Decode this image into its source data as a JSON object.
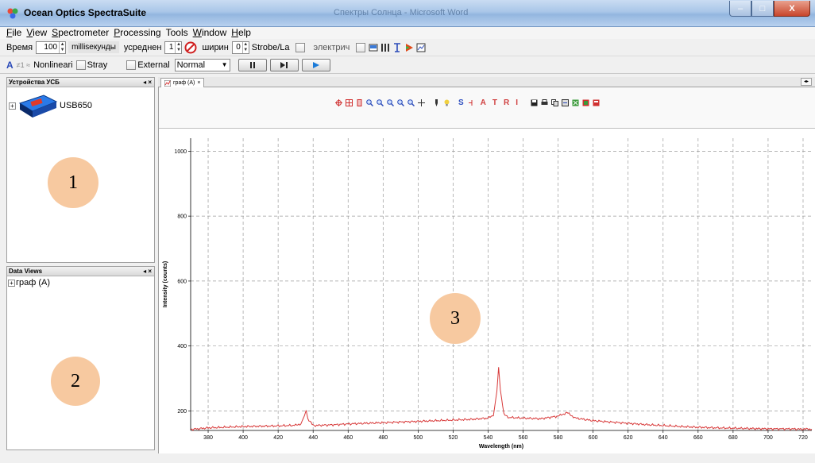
{
  "window": {
    "title": "Ocean Optics SpectraSuite",
    "background_title": "Спектры Солнца - Microsoft Word",
    "minimize_label": "–",
    "maximize_label": "□",
    "close_label": "X"
  },
  "menu": {
    "items": [
      {
        "key": "F",
        "rest": "ile"
      },
      {
        "key": "V",
        "rest": "iew"
      },
      {
        "key": "S",
        "rest": "pectrometer"
      },
      {
        "key": "P",
        "rest": "rocessing"
      },
      {
        "key": "",
        "rest": "Tools"
      },
      {
        "key": "W",
        "rest": "indow"
      },
      {
        "key": "H",
        "rest": "elp"
      }
    ]
  },
  "toolbar1": {
    "time_label": "Время",
    "time_value": "100",
    "time_unit": "millisекунды",
    "avg_label": "усреднен",
    "avg_value": "1",
    "width_label": "ширин",
    "width_value": "0",
    "strobe_label": "Strobe/La",
    "electric_label": "электрич"
  },
  "toolbar2": {
    "a_label": "A",
    "nonlinear_label": "Nonlineari",
    "stray_label": "Stray",
    "external_label": "External",
    "mode_value": "Normal"
  },
  "devices_panel": {
    "title": "Устройства УСБ",
    "device_name": "USB650"
  },
  "dataviews_panel": {
    "title": "Data Views",
    "item": "граф (A)"
  },
  "graph": {
    "tab_label": "граф (A)",
    "toolbar_letters": [
      "S",
      "A",
      "T",
      "R",
      "I"
    ]
  },
  "callouts": {
    "one": "1",
    "two": "2",
    "three": "3"
  },
  "colors": {
    "spectrum_line": "#d83a3a",
    "callout_fill": "#f7c9a0",
    "grid": "#9a9a9a"
  },
  "chart_data": {
    "type": "line",
    "xlabel": "Wavelength (nm)",
    "ylabel": "Intensity (counts)",
    "xlim": [
      370,
      725
    ],
    "ylim": [
      140,
      1040
    ],
    "x_ticks": [
      380,
      400,
      420,
      440,
      460,
      480,
      500,
      520,
      540,
      560,
      580,
      600,
      620,
      640,
      660,
      680,
      700,
      720
    ],
    "y_ticks": [
      200,
      400,
      600,
      800,
      1000
    ],
    "grid": true,
    "series": [
      {
        "x": [
          370,
          380,
          390,
          400,
          410,
          420,
          430,
          433,
          435,
          436,
          437,
          440,
          450,
          460,
          470,
          480,
          490,
          500,
          510,
          520,
          530,
          540,
          543,
          545,
          546,
          547,
          549,
          552,
          560,
          570,
          580,
          585,
          590,
          600,
          610,
          620,
          630,
          640,
          650,
          660,
          670,
          680,
          690,
          700,
          710,
          720,
          725
        ],
        "y": [
          143,
          148,
          150,
          152,
          153,
          154,
          156,
          160,
          185,
          202,
          175,
          155,
          157,
          160,
          162,
          164,
          166,
          168,
          170,
          172,
          174,
          178,
          185,
          260,
          335,
          265,
          190,
          180,
          178,
          176,
          184,
          195,
          178,
          170,
          166,
          162,
          158,
          155,
          152,
          150,
          148,
          147,
          146,
          145,
          145,
          144,
          144
        ]
      }
    ]
  }
}
